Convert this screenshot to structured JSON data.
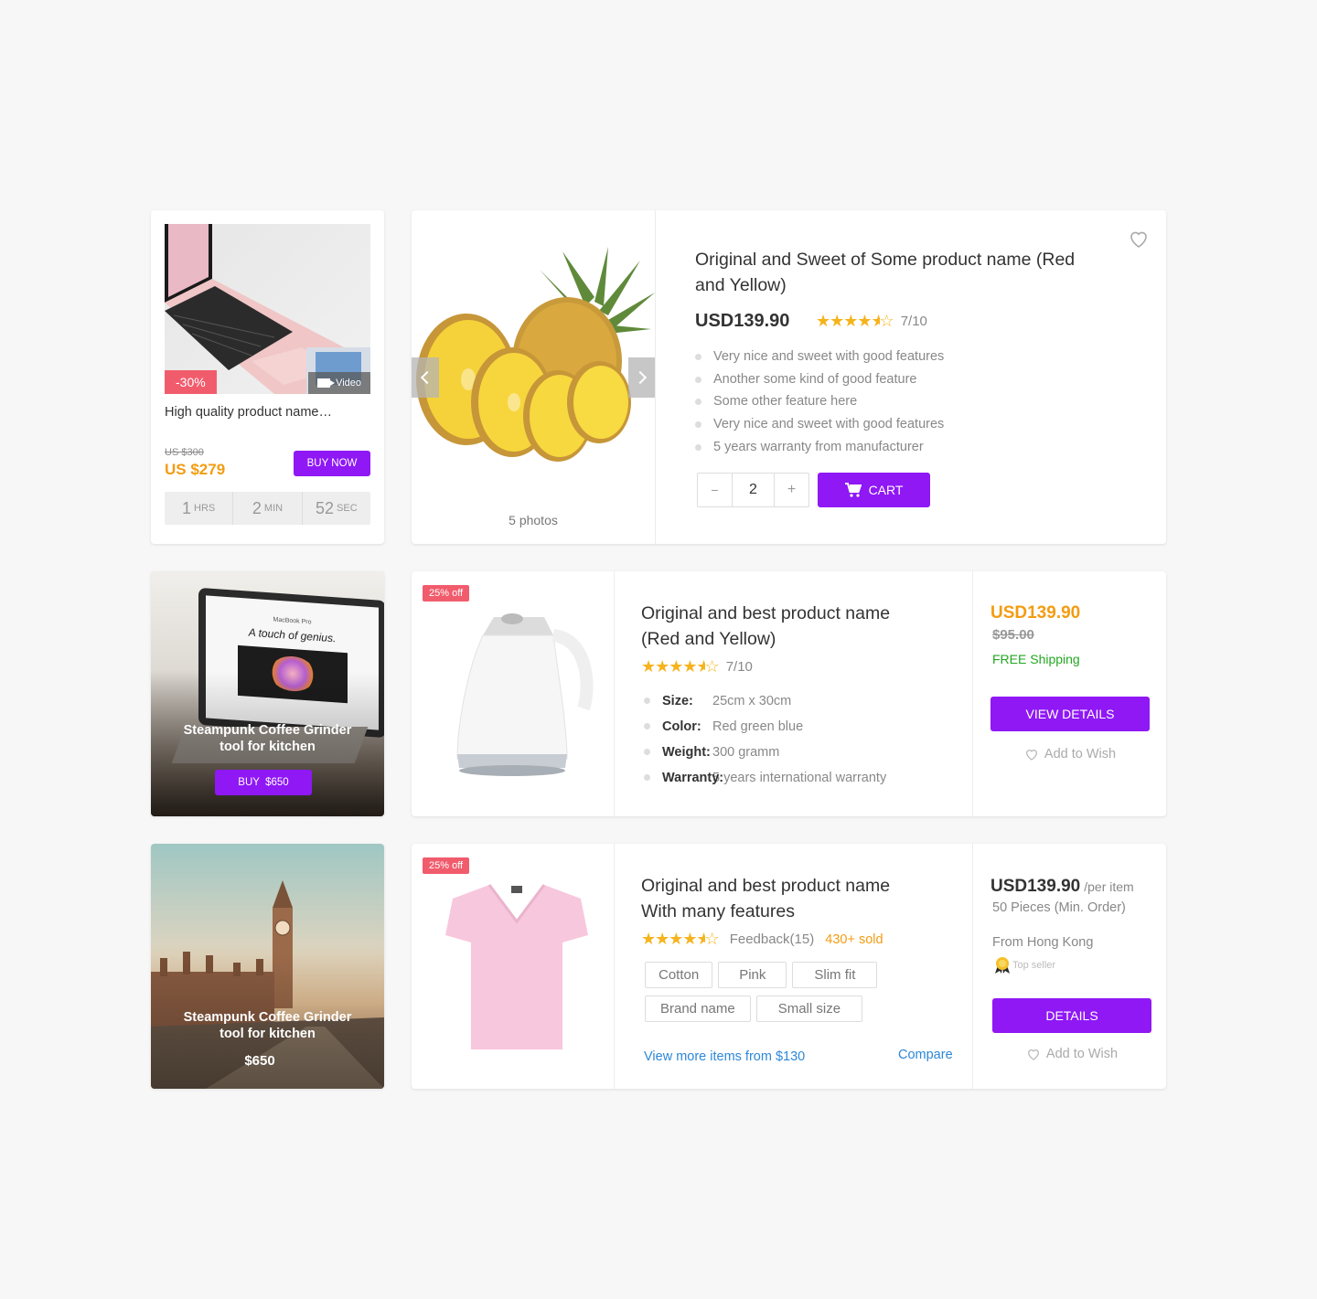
{
  "card1": {
    "discount": "-30%",
    "video_label": "Video",
    "title": "High quality product name…",
    "old_price": "US $300",
    "price": "US $279",
    "buy_label": "BUY NOW",
    "timer": [
      {
        "value": "1",
        "unit": "HRS"
      },
      {
        "value": "2",
        "unit": "MIN"
      },
      {
        "value": "52",
        "unit": "SEC"
      }
    ]
  },
  "card2": {
    "photos_label": "5 photos",
    "title": "Original and Sweet of Some product name (Red and Yellow)",
    "price": "USD139.90",
    "rating": "7/10",
    "rating_stars": 4.5,
    "features": [
      "Very nice and sweet with good features",
      "Another some kind of good feature",
      "Some other feature here",
      "Very nice and sweet with good features",
      "5 years warranty from manufacturer"
    ],
    "qty_minus": "−",
    "qty_value": "2",
    "qty_plus": "+",
    "cart_label": "CART"
  },
  "promo1": {
    "screen_small": "MacBook Pro",
    "screen_headline": "A touch of genius.",
    "title": "Steampunk Coffee Grinder tool for kitchen",
    "buy_label": "BUY  $650"
  },
  "card3": {
    "badge": "25% off",
    "title": "Original and best product name (Red and Yellow)",
    "rating": "7/10",
    "rating_stars": 4.5,
    "specs": [
      {
        "label": "Size:",
        "value": "25cm x 30cm"
      },
      {
        "label": "Color:",
        "value": "Red green blue"
      },
      {
        "label": "Weight:",
        "value": "300 gramm"
      },
      {
        "label": "Warranty:",
        "value": "5 years international warranty"
      }
    ],
    "price": "USD139.90",
    "old_price": "$95.00",
    "shipping": "FREE Shipping",
    "details_label": "VIEW DETAILS",
    "wish_label": "Add to Wish"
  },
  "promo2": {
    "title": "Steampunk Coffee Grinder tool for kitchen",
    "price": "$650"
  },
  "card4": {
    "badge": "25% off",
    "title": "Original and best product name With many features",
    "rating_stars": 4.5,
    "feedback": "Feedback(15)",
    "sold": "430+ sold",
    "tags": [
      "Cotton",
      "Pink",
      "Slim fit",
      "Brand name",
      "Small size"
    ],
    "more_link": "View more items from $130",
    "compare_link": "Compare",
    "price": "USD139.90",
    "per_item": "/per item",
    "min_order": "50 Pieces (Min. Order)",
    "origin": "From Hong Kong",
    "seller_badge": "Top seller",
    "details_label": "DETAILS",
    "wish_label": "Add to Wish"
  },
  "colors": {
    "accent": "#8f18f5",
    "orange": "#f39c12",
    "green": "#22a722",
    "link": "#2d87d8",
    "badge": "#f15c6d"
  }
}
